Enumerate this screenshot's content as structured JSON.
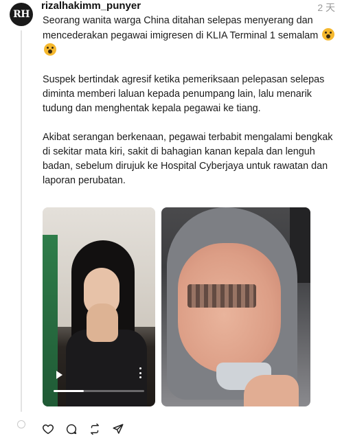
{
  "post": {
    "avatar_text": "RH",
    "username": "rizalhakimm_punyer",
    "timestamp": "2 天",
    "paragraphs": [
      "Seorang wanita warga China ditahan selepas menyerang dan mencederakan pegawai imigresen di KLIA Terminal 1 semalam",
      "Suspek bertindak agresif ketika pemeriksaan pelepasan selepas diminta memberi laluan kepada penumpang lain, lalu menarik tudung dan menghentak kepala pegawai ke tiang.",
      "Akibat serangan berkenaan, pegawai terbabit mengalami bengkak di sekitar mata kiri, sakit di bahagian kanan kepala dan lenguh badan, sebelum dirujuk ke Hospital Cyberjaya untuk rawatan dan laporan perubatan."
    ],
    "emojis": [
      "shocked-face-emoji",
      "shocked-face-emoji"
    ]
  },
  "media": {
    "video": {
      "progress": 0.33,
      "icons": [
        "play-icon",
        "more-vertical-icon"
      ]
    },
    "photo": {
      "icons": []
    }
  },
  "actions": [
    "heart-icon",
    "comment-icon",
    "repost-icon",
    "share-icon"
  ],
  "colors": {
    "accent": "#111111",
    "muted": "#999999",
    "thread_line": "#e3e3e3"
  }
}
